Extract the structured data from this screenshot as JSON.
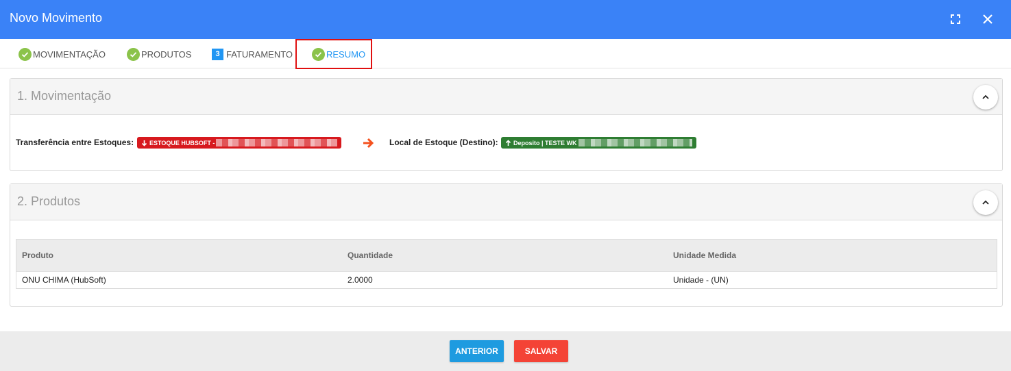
{
  "window": {
    "title": "Novo Movimento",
    "icons": {
      "fullscreen": "fullscreen-icon",
      "close": "close-icon"
    }
  },
  "tabs": [
    {
      "label": "MOVIMENTAÇÃO",
      "state": "done"
    },
    {
      "label": "PRODUTOS",
      "state": "done"
    },
    {
      "label": "FATURAMENTO",
      "number": "3",
      "state": "pending"
    },
    {
      "label": "RESUMO",
      "state": "active"
    }
  ],
  "section1": {
    "title": "1. Movimentação",
    "origin_label": "Transferência entre Estoques:",
    "origin_value": "ESTOQUE HUBSOFT -",
    "destination_label": "Local de Estoque (Destino):",
    "destination_value": "Deposito | TESTE WK",
    "colors": {
      "origin": "#d7191e",
      "destination": "#2e7d32",
      "arrow": "#f4511e"
    }
  },
  "section2": {
    "title": "2. Produtos",
    "columns": [
      "Produto",
      "Quantidade",
      "Unidade Medida"
    ],
    "rows": [
      [
        "ONU CHIMA (HubSoft)",
        "2.0000",
        "Unidade - (UN)"
      ]
    ]
  },
  "footer": {
    "prev_label": "ANTERIOR",
    "save_label": "SALVAR",
    "colors": {
      "prev": "#1e9be0",
      "save": "#f44336"
    }
  },
  "colors": {
    "header": "#3a82f7",
    "active_tab": "#2196f3",
    "check": "#8bc34a"
  }
}
